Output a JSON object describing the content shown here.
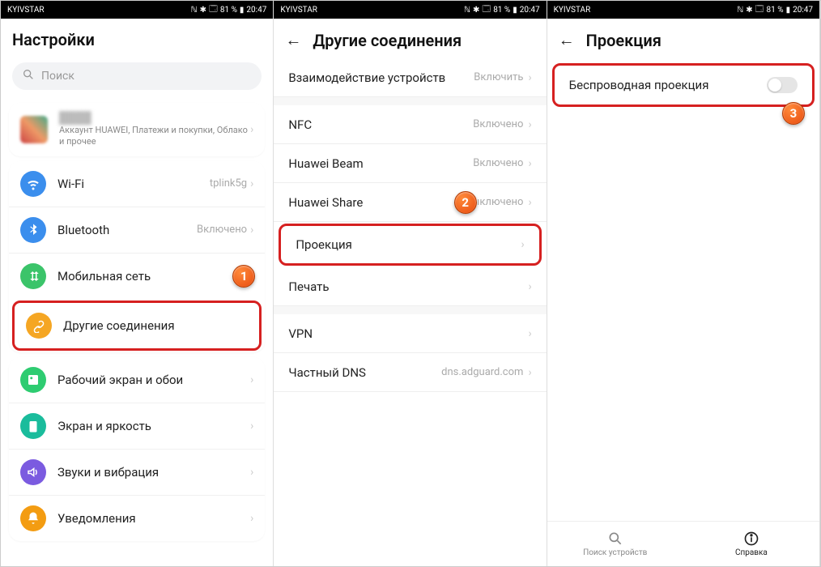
{
  "status": {
    "carrier": "KYIVSTAR",
    "battery": "81 %",
    "time": "20:47"
  },
  "panel1": {
    "title": "Настройки",
    "search_placeholder": "Поиск",
    "account_sub": "Аккаунт HUAWEI, Платежи и покупки, Облако и прочее",
    "rows": {
      "wifi": {
        "label": "Wi-Fi",
        "value": "tplink5g"
      },
      "bluetooth": {
        "label": "Bluetooth",
        "value": "Включено"
      },
      "mobile": {
        "label": "Мобильная сеть",
        "value": ""
      },
      "other": {
        "label": "Другие соединения",
        "value": ""
      },
      "wallpaper": {
        "label": "Рабочий экран и обои",
        "value": ""
      },
      "display": {
        "label": "Экран и яркость",
        "value": ""
      },
      "sound": {
        "label": "Звуки и вибрация",
        "value": ""
      },
      "notif": {
        "label": "Уведомления",
        "value": ""
      }
    },
    "badge": "1"
  },
  "panel2": {
    "title": "Другие соединения",
    "rows": {
      "multi": {
        "label": "Взаимодействие устройств",
        "value": "Включить"
      },
      "nfc": {
        "label": "NFC",
        "value": "Включено"
      },
      "beam": {
        "label": "Huawei Beam",
        "value": "Включено"
      },
      "share": {
        "label": "Huawei Share",
        "value": "Выключено"
      },
      "projection": {
        "label": "Проекция",
        "value": ""
      },
      "print": {
        "label": "Печать",
        "value": ""
      },
      "vpn": {
        "label": "VPN",
        "value": ""
      },
      "dns": {
        "label": "Частный DNS",
        "value": "dns.adguard.com"
      }
    },
    "badge": "2"
  },
  "panel3": {
    "title": "Проекция",
    "wireless": "Беспроводная проекция",
    "badge": "3",
    "nav": {
      "search": "Поиск устройств",
      "help": "Справка"
    }
  }
}
